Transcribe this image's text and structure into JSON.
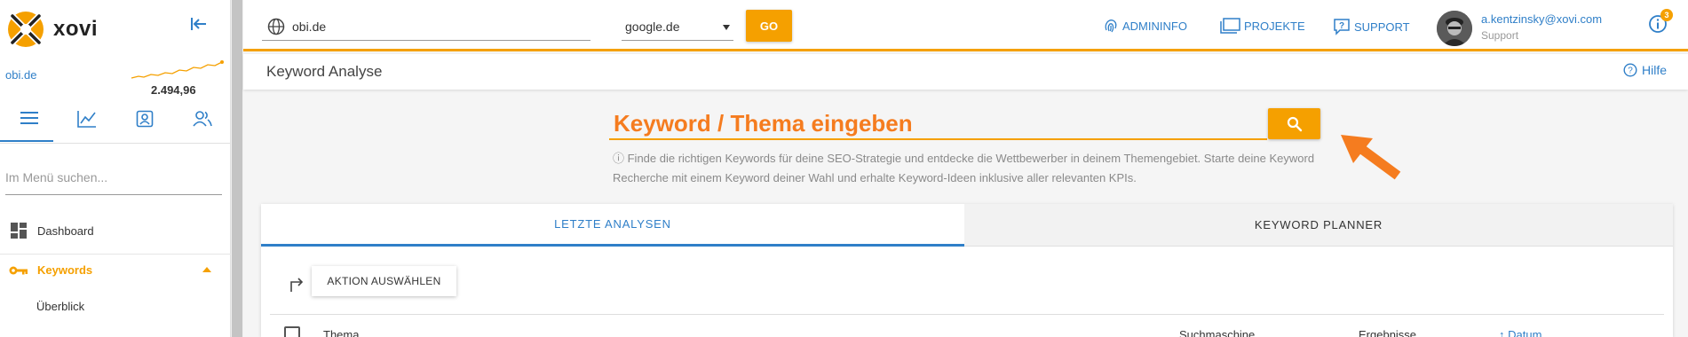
{
  "sidebar": {
    "logo_text": "xovi",
    "domain": "obi.de",
    "sparkline_value": "2.494,96",
    "search_placeholder": "Im Menü suchen...",
    "items": [
      {
        "label": "Dashboard",
        "icon": "dashboard-icon"
      },
      {
        "label": "Keywords",
        "icon": "key-icon"
      },
      {
        "label": "Überblick"
      }
    ],
    "nav_icons": [
      "menu-icon",
      "chart-icon",
      "contact-icon",
      "users-icon"
    ]
  },
  "topbar": {
    "url_value": "obi.de",
    "engine_value": "google.de",
    "go_label": "GO",
    "links": {
      "admininfo": "ADMININFO",
      "projekte": "PROJEKTE",
      "support": "SUPPORT"
    },
    "user": {
      "email": "a.kentzinsky@xovi.com",
      "role": "Support"
    },
    "info_badge": "3"
  },
  "titlebar": {
    "title": "Keyword Analyse",
    "help_label": "Hilfe"
  },
  "search": {
    "placeholder": "Keyword / Thema eingeben",
    "hint": "ⓘ Finde die richtigen Keywords für deine SEO-Strategie und entdecke die Wettbewerber in deinem Themengebiet. Starte deine Keyword Recherche mit einem Keyword deiner Wahl und erhalte Keyword-Ideen inklusive aller relevanten KPIs."
  },
  "tabs": {
    "last": "LETZTE ANALYSEN",
    "planner": "KEYWORD PLANNER"
  },
  "table": {
    "action_label": "AKTION AUSWÄHLEN",
    "columns": [
      "Thema",
      "Suchmaschine",
      "Ergebnisse",
      "↑ Datum"
    ]
  },
  "colors": {
    "accent": "#f5a000",
    "link": "#2f7fc8",
    "keyword_text": "#f57c1f"
  }
}
